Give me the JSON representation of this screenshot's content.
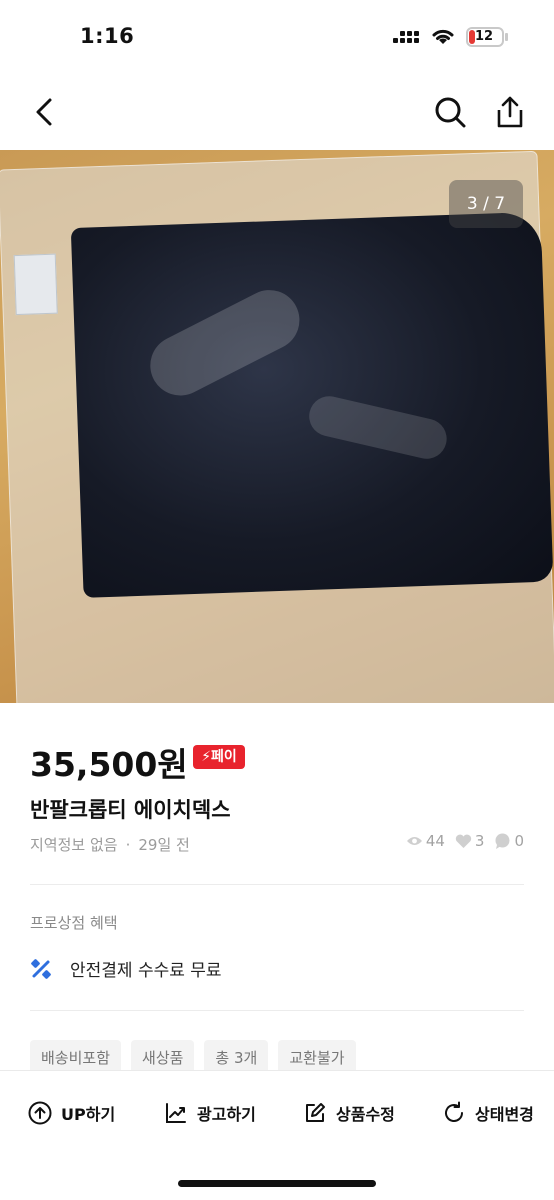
{
  "status_bar": {
    "time": "1:16",
    "battery": "12"
  },
  "nav": {
    "back_icon": "chevron-left-icon",
    "search_icon": "search-icon",
    "share_icon": "share-icon"
  },
  "photo": {
    "counter": "3 / 7"
  },
  "product": {
    "price": "35,500원",
    "pay_badge": "페이",
    "title": "반팔크롭티 에이치덱스",
    "location": "지역정보 없음",
    "time_ago": "29일 전",
    "views": "44",
    "likes": "3",
    "chats": "0"
  },
  "benefits": {
    "title": "프로상점 혜택",
    "items": [
      {
        "label": "안전결제 수수료 무료",
        "icon": "discount-icon"
      }
    ]
  },
  "tags": [
    "배송비포함",
    "새상품",
    "총 3개",
    "교환불가"
  ],
  "bottom_actions": [
    {
      "label": "UP하기",
      "icon": "arrow-up-circle-icon"
    },
    {
      "label": "광고하기",
      "icon": "trend-chart-icon"
    },
    {
      "label": "상품수정",
      "icon": "edit-icon"
    },
    {
      "label": "상태변경",
      "icon": "refresh-icon"
    }
  ],
  "colors": {
    "accent_red": "#e8232d",
    "discount_blue": "#2f6fde"
  }
}
